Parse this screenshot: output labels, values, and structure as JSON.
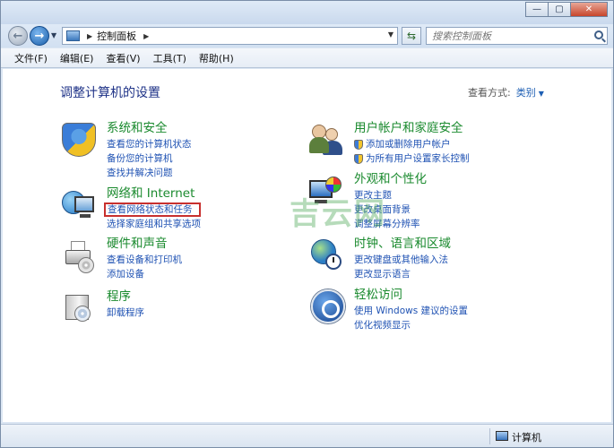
{
  "window": {
    "title": "",
    "colors": {
      "category_title": "#1a8a2e",
      "link": "#1f52b3",
      "page_title": "#1e3287",
      "highlight_box": "#c8302e"
    }
  },
  "address": {
    "path": "控制面板",
    "search_placeholder": "搜索控制面板"
  },
  "menu": [
    "文件(F)",
    "编辑(E)",
    "查看(V)",
    "工具(T)",
    "帮助(H)"
  ],
  "page": {
    "title": "调整计算机的设置",
    "view_label": "查看方式:",
    "view_value": "类别"
  },
  "categories": {
    "security": {
      "title": "系统和安全",
      "links": [
        "查看您的计算机状态",
        "备份您的计算机",
        "查找并解决问题"
      ]
    },
    "network": {
      "title": "网络和 Internet",
      "links": [
        "查看网络状态和任务",
        "选择家庭组和共享选项"
      ]
    },
    "hardware": {
      "title": "硬件和声音",
      "links": [
        "查看设备和打印机",
        "添加设备"
      ]
    },
    "programs": {
      "title": "程序",
      "links": [
        "卸载程序"
      ]
    },
    "users": {
      "title": "用户帐户和家庭安全",
      "links": [
        "添加或删除用户帐户",
        "为所有用户设置家长控制"
      ]
    },
    "appearance": {
      "title": "外观和个性化",
      "links": [
        "更改主题",
        "更改桌面背景",
        "调整屏幕分辨率"
      ]
    },
    "clock": {
      "title": "时钟、语言和区域",
      "links": [
        "更改键盘或其他输入法",
        "更改显示语言"
      ]
    },
    "access": {
      "title": "轻松访问",
      "links": [
        "使用 Windows 建议的设置",
        "优化视频显示"
      ]
    }
  },
  "icons": {
    "security": "shield-icon",
    "users": "users-icon",
    "network": "network-globe-icon",
    "appearance": "monitor-palette-icon",
    "hardware": "printer-icon",
    "clock": "clock-globe-icon",
    "programs": "program-box-icon",
    "access": "ease-of-access-icon"
  },
  "watermark": "吉云网",
  "status": {
    "text": "计算机"
  }
}
